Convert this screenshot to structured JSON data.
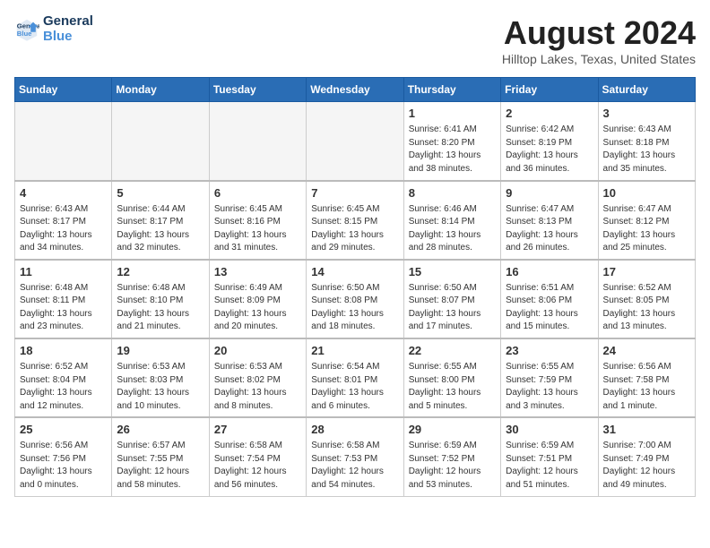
{
  "header": {
    "logo_line1": "General",
    "logo_line2": "Blue",
    "month": "August 2024",
    "location": "Hilltop Lakes, Texas, United States"
  },
  "weekdays": [
    "Sunday",
    "Monday",
    "Tuesday",
    "Wednesday",
    "Thursday",
    "Friday",
    "Saturday"
  ],
  "weeks": [
    [
      {
        "day": "",
        "sunrise": "",
        "sunset": "",
        "daylight": "",
        "empty": true
      },
      {
        "day": "",
        "sunrise": "",
        "sunset": "",
        "daylight": "",
        "empty": true
      },
      {
        "day": "",
        "sunrise": "",
        "sunset": "",
        "daylight": "",
        "empty": true
      },
      {
        "day": "",
        "sunrise": "",
        "sunset": "",
        "daylight": "",
        "empty": true
      },
      {
        "day": "1",
        "sunrise": "Sunrise: 6:41 AM",
        "sunset": "Sunset: 8:20 PM",
        "daylight": "Daylight: 13 hours and 38 minutes.",
        "empty": false
      },
      {
        "day": "2",
        "sunrise": "Sunrise: 6:42 AM",
        "sunset": "Sunset: 8:19 PM",
        "daylight": "Daylight: 13 hours and 36 minutes.",
        "empty": false
      },
      {
        "day": "3",
        "sunrise": "Sunrise: 6:43 AM",
        "sunset": "Sunset: 8:18 PM",
        "daylight": "Daylight: 13 hours and 35 minutes.",
        "empty": false
      }
    ],
    [
      {
        "day": "4",
        "sunrise": "Sunrise: 6:43 AM",
        "sunset": "Sunset: 8:17 PM",
        "daylight": "Daylight: 13 hours and 34 minutes.",
        "empty": false
      },
      {
        "day": "5",
        "sunrise": "Sunrise: 6:44 AM",
        "sunset": "Sunset: 8:17 PM",
        "daylight": "Daylight: 13 hours and 32 minutes.",
        "empty": false
      },
      {
        "day": "6",
        "sunrise": "Sunrise: 6:45 AM",
        "sunset": "Sunset: 8:16 PM",
        "daylight": "Daylight: 13 hours and 31 minutes.",
        "empty": false
      },
      {
        "day": "7",
        "sunrise": "Sunrise: 6:45 AM",
        "sunset": "Sunset: 8:15 PM",
        "daylight": "Daylight: 13 hours and 29 minutes.",
        "empty": false
      },
      {
        "day": "8",
        "sunrise": "Sunrise: 6:46 AM",
        "sunset": "Sunset: 8:14 PM",
        "daylight": "Daylight: 13 hours and 28 minutes.",
        "empty": false
      },
      {
        "day": "9",
        "sunrise": "Sunrise: 6:47 AM",
        "sunset": "Sunset: 8:13 PM",
        "daylight": "Daylight: 13 hours and 26 minutes.",
        "empty": false
      },
      {
        "day": "10",
        "sunrise": "Sunrise: 6:47 AM",
        "sunset": "Sunset: 8:12 PM",
        "daylight": "Daylight: 13 hours and 25 minutes.",
        "empty": false
      }
    ],
    [
      {
        "day": "11",
        "sunrise": "Sunrise: 6:48 AM",
        "sunset": "Sunset: 8:11 PM",
        "daylight": "Daylight: 13 hours and 23 minutes.",
        "empty": false
      },
      {
        "day": "12",
        "sunrise": "Sunrise: 6:48 AM",
        "sunset": "Sunset: 8:10 PM",
        "daylight": "Daylight: 13 hours and 21 minutes.",
        "empty": false
      },
      {
        "day": "13",
        "sunrise": "Sunrise: 6:49 AM",
        "sunset": "Sunset: 8:09 PM",
        "daylight": "Daylight: 13 hours and 20 minutes.",
        "empty": false
      },
      {
        "day": "14",
        "sunrise": "Sunrise: 6:50 AM",
        "sunset": "Sunset: 8:08 PM",
        "daylight": "Daylight: 13 hours and 18 minutes.",
        "empty": false
      },
      {
        "day": "15",
        "sunrise": "Sunrise: 6:50 AM",
        "sunset": "Sunset: 8:07 PM",
        "daylight": "Daylight: 13 hours and 17 minutes.",
        "empty": false
      },
      {
        "day": "16",
        "sunrise": "Sunrise: 6:51 AM",
        "sunset": "Sunset: 8:06 PM",
        "daylight": "Daylight: 13 hours and 15 minutes.",
        "empty": false
      },
      {
        "day": "17",
        "sunrise": "Sunrise: 6:52 AM",
        "sunset": "Sunset: 8:05 PM",
        "daylight": "Daylight: 13 hours and 13 minutes.",
        "empty": false
      }
    ],
    [
      {
        "day": "18",
        "sunrise": "Sunrise: 6:52 AM",
        "sunset": "Sunset: 8:04 PM",
        "daylight": "Daylight: 13 hours and 12 minutes.",
        "empty": false
      },
      {
        "day": "19",
        "sunrise": "Sunrise: 6:53 AM",
        "sunset": "Sunset: 8:03 PM",
        "daylight": "Daylight: 13 hours and 10 minutes.",
        "empty": false
      },
      {
        "day": "20",
        "sunrise": "Sunrise: 6:53 AM",
        "sunset": "Sunset: 8:02 PM",
        "daylight": "Daylight: 13 hours and 8 minutes.",
        "empty": false
      },
      {
        "day": "21",
        "sunrise": "Sunrise: 6:54 AM",
        "sunset": "Sunset: 8:01 PM",
        "daylight": "Daylight: 13 hours and 6 minutes.",
        "empty": false
      },
      {
        "day": "22",
        "sunrise": "Sunrise: 6:55 AM",
        "sunset": "Sunset: 8:00 PM",
        "daylight": "Daylight: 13 hours and 5 minutes.",
        "empty": false
      },
      {
        "day": "23",
        "sunrise": "Sunrise: 6:55 AM",
        "sunset": "Sunset: 7:59 PM",
        "daylight": "Daylight: 13 hours and 3 minutes.",
        "empty": false
      },
      {
        "day": "24",
        "sunrise": "Sunrise: 6:56 AM",
        "sunset": "Sunset: 7:58 PM",
        "daylight": "Daylight: 13 hours and 1 minute.",
        "empty": false
      }
    ],
    [
      {
        "day": "25",
        "sunrise": "Sunrise: 6:56 AM",
        "sunset": "Sunset: 7:56 PM",
        "daylight": "Daylight: 13 hours and 0 minutes.",
        "empty": false
      },
      {
        "day": "26",
        "sunrise": "Sunrise: 6:57 AM",
        "sunset": "Sunset: 7:55 PM",
        "daylight": "Daylight: 12 hours and 58 minutes.",
        "empty": false
      },
      {
        "day": "27",
        "sunrise": "Sunrise: 6:58 AM",
        "sunset": "Sunset: 7:54 PM",
        "daylight": "Daylight: 12 hours and 56 minutes.",
        "empty": false
      },
      {
        "day": "28",
        "sunrise": "Sunrise: 6:58 AM",
        "sunset": "Sunset: 7:53 PM",
        "daylight": "Daylight: 12 hours and 54 minutes.",
        "empty": false
      },
      {
        "day": "29",
        "sunrise": "Sunrise: 6:59 AM",
        "sunset": "Sunset: 7:52 PM",
        "daylight": "Daylight: 12 hours and 53 minutes.",
        "empty": false
      },
      {
        "day": "30",
        "sunrise": "Sunrise: 6:59 AM",
        "sunset": "Sunset: 7:51 PM",
        "daylight": "Daylight: 12 hours and 51 minutes.",
        "empty": false
      },
      {
        "day": "31",
        "sunrise": "Sunrise: 7:00 AM",
        "sunset": "Sunset: 7:49 PM",
        "daylight": "Daylight: 12 hours and 49 minutes.",
        "empty": false
      }
    ]
  ]
}
